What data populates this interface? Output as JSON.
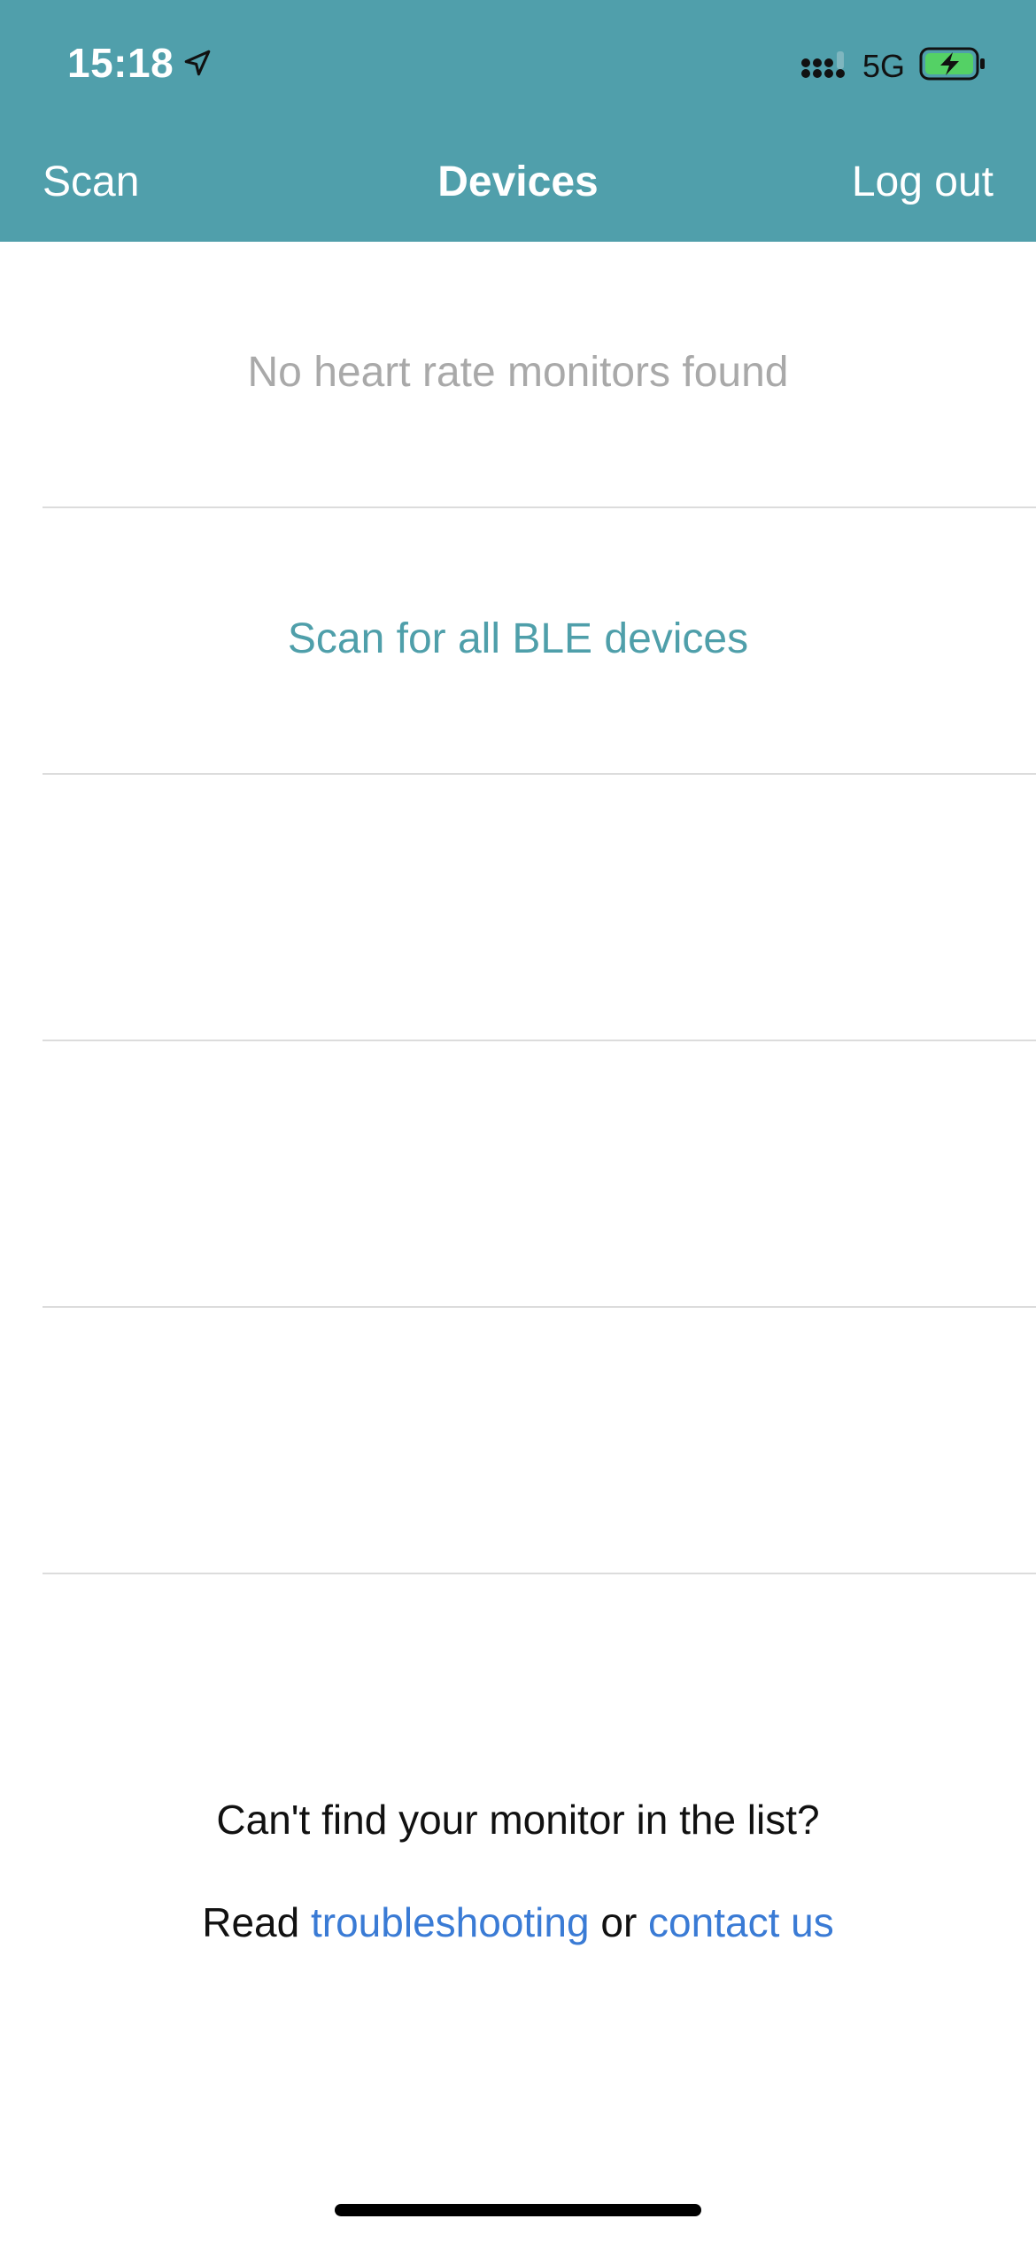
{
  "status_bar": {
    "time": "15:18",
    "network": "5G"
  },
  "nav": {
    "left_label": "Scan",
    "title": "Devices",
    "right_label": "Log out"
  },
  "list": {
    "empty_message": "No heart rate monitors found",
    "scan_all_label": "Scan for all BLE devices"
  },
  "footer": {
    "question": "Can't find your monitor in the list?",
    "read_prefix": "Read",
    "troubleshooting_link": "troubleshooting",
    "or_text": "or",
    "contact_link": "contact us"
  },
  "colors": {
    "header_bg": "#509fab",
    "accent": "#4f9faa",
    "link": "#3a7bd5",
    "battery_fill": "#54d165"
  },
  "icons": {
    "location": "location-arrow-icon",
    "signal": "cellular-signal-icon",
    "battery": "battery-charging-icon"
  }
}
